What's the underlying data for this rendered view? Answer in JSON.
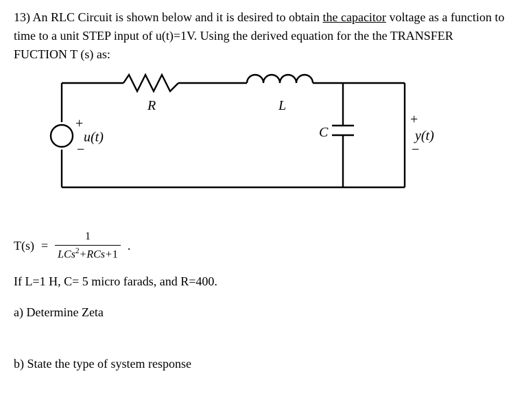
{
  "question": {
    "number": "13)",
    "text_part1": "An RLC Circuit is shown below and it is desired to obtain ",
    "text_underlined": "the capacitor",
    "text_part2": " voltage as a function to time to a unit STEP input of  u(t)=1V. Using the derived equation for the the TRANSFER FUCTION T (s) as:"
  },
  "circuit": {
    "label_R": "R",
    "label_L": "L",
    "label_C": "C",
    "label_ut": "u(t)",
    "label_yt": "y(t)",
    "plus": "+",
    "minus": "−"
  },
  "tf": {
    "lhs": "T(s)",
    "eq": "=",
    "num": "1",
    "den_html": "LCs²+RCs+1",
    "period": "."
  },
  "params": "If L=1 H, C= 5 micro farads, and R=400.",
  "part_a": "a) Determine Zeta",
  "part_b": "b) State the type of system response"
}
